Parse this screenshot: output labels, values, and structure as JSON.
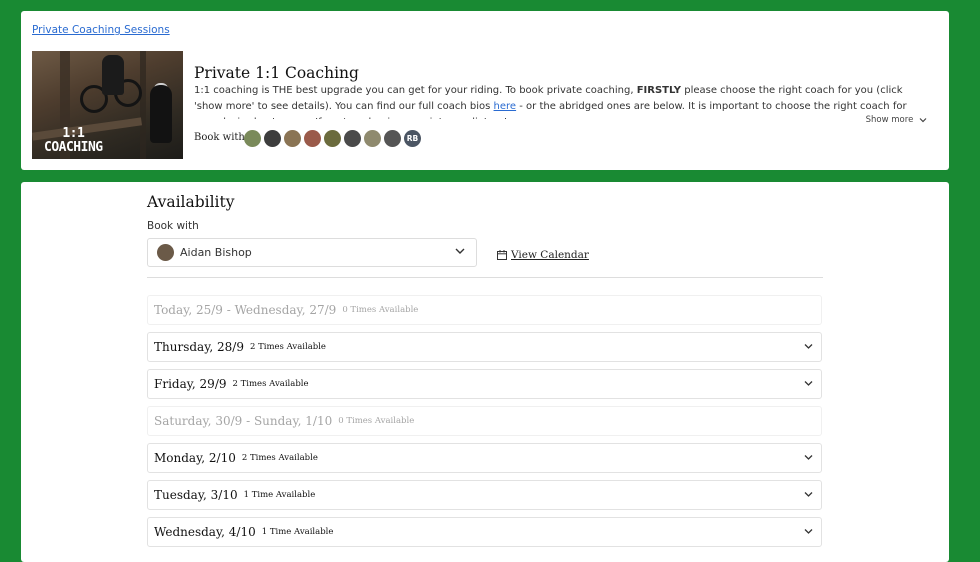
{
  "header": {
    "breadcrumb": "Private Coaching Sessions",
    "hero_caption_line1": "1:1",
    "hero_caption_line2": "COACHING",
    "title": "Private 1:1 Coaching",
    "desc_part1": "1:1 coaching is THE best upgrade you can get for your riding. To book private coaching, ",
    "desc_bold": "FIRSTLY",
    "desc_part2": " please choose the right coach for you (click 'show more' to see details). You can find our full coach bios ",
    "desc_link": "here",
    "desc_part3": " - or the abridged ones are below. It is important to choose the right coach for your desired outcomes. If you're a beginner or intermediate - I...",
    "show_more": "Show more",
    "book_with_label": "Book with",
    "avatars": [
      {
        "color": "#7a8a5a",
        "initials": ""
      },
      {
        "color": "#3d3d3d",
        "initials": ""
      },
      {
        "color": "#8a7454",
        "initials": ""
      },
      {
        "color": "#9a5a4a",
        "initials": ""
      },
      {
        "color": "#6b6b3d",
        "initials": ""
      },
      {
        "color": "#4a4a4a",
        "initials": ""
      },
      {
        "color": "#8f8a6e",
        "initials": ""
      },
      {
        "color": "#555555",
        "initials": ""
      },
      {
        "color": "#4b5563",
        "initials": "RB"
      }
    ]
  },
  "availability": {
    "title": "Availability",
    "book_with_label": "Book with",
    "selected_coach": "Aidan Bishop",
    "view_calendar": "View Calendar",
    "days": [
      {
        "name": "Today, 25/9 - Wednesday, 27/9",
        "count": "0 Times Available",
        "available": false
      },
      {
        "name": "Thursday, 28/9",
        "count": "2 Times Available",
        "available": true
      },
      {
        "name": "Friday, 29/9",
        "count": "2 Times Available",
        "available": true
      },
      {
        "name": "Saturday, 30/9 - Sunday, 1/10",
        "count": "0 Times Available",
        "available": false
      },
      {
        "name": "Monday, 2/10",
        "count": "2 Times Available",
        "available": true
      },
      {
        "name": "Tuesday, 3/10",
        "count": "1 Time Available",
        "available": true
      },
      {
        "name": "Wednesday, 4/10",
        "count": "1 Time Available",
        "available": true
      }
    ]
  }
}
